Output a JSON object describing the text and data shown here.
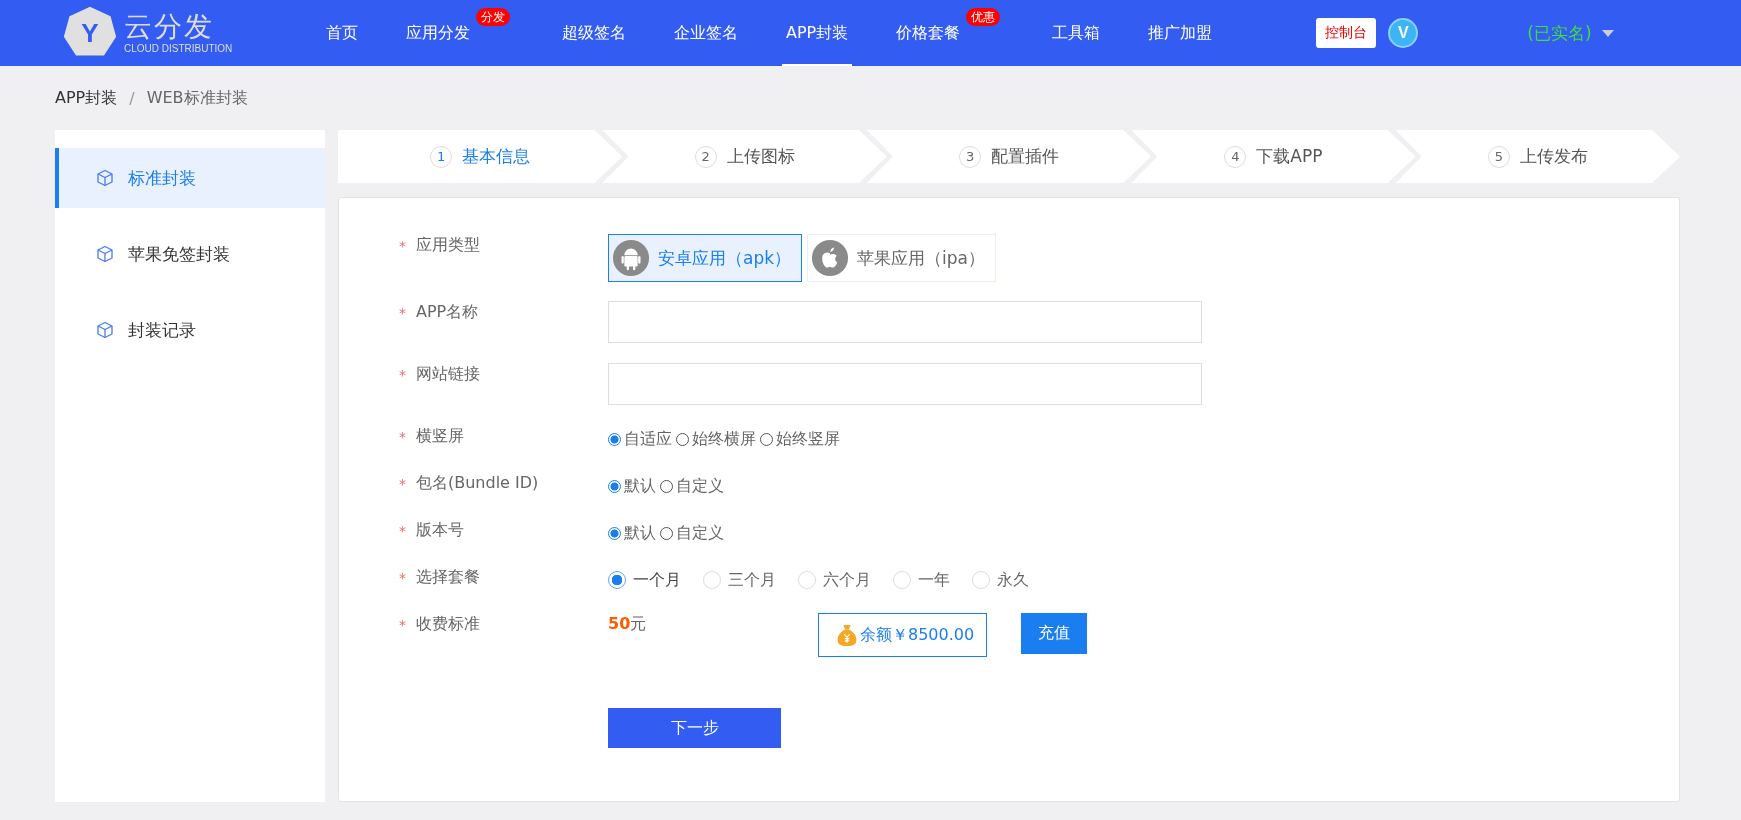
{
  "header": {
    "logo": {
      "mark": "Y",
      "title": "云分发",
      "subtitle": "CLOUD DISTRIBUTION"
    },
    "nav": [
      {
        "label": "首页",
        "selected": false
      },
      {
        "label": "应用分发",
        "selected": false,
        "badge": "分发"
      },
      {
        "label": "超级签名",
        "selected": false
      },
      {
        "label": "企业签名",
        "selected": false
      },
      {
        "label": "APP封装",
        "selected": true
      },
      {
        "label": "价格套餐",
        "selected": false,
        "badge": "优惠"
      },
      {
        "label": "工具箱",
        "selected": false
      },
      {
        "label": "推广加盟",
        "selected": false
      }
    ],
    "console_button": "控制台",
    "avatar_letter": "V",
    "user_status": "(已实名)"
  },
  "breadcrumb": {
    "items": [
      "APP封装",
      "WEB标准封装"
    ],
    "separator": "/"
  },
  "sidebar": {
    "items": [
      {
        "label": "标准封装",
        "selected": true
      },
      {
        "label": "苹果免签封装",
        "selected": false
      },
      {
        "label": "封装记录",
        "selected": false
      }
    ]
  },
  "steps": [
    {
      "number": "1",
      "label": "基本信息",
      "selected": true
    },
    {
      "number": "2",
      "label": "上传图标",
      "selected": false
    },
    {
      "number": "3",
      "label": "配置插件",
      "selected": false
    },
    {
      "number": "4",
      "label": "下载APP",
      "selected": false
    },
    {
      "number": "5",
      "label": "上传发布",
      "selected": false
    }
  ],
  "form": {
    "rows": [
      {
        "kind": "apptype",
        "label": "应用类型",
        "required_mark": "*",
        "options": [
          {
            "label": "安卓应用（apk）",
            "selected": true
          },
          {
            "label": "苹果应用（ipa）",
            "selected": false
          }
        ]
      },
      {
        "kind": "input",
        "label": "APP名称",
        "required_mark": "*"
      },
      {
        "kind": "input",
        "label": "网站链接",
        "required_mark": "*"
      },
      {
        "kind": "radio",
        "label": "横竖屏",
        "required_mark": "*",
        "options": [
          {
            "label": "自适应",
            "selected": true
          },
          {
            "label": "始终横屏",
            "selected": false
          },
          {
            "label": "始终竖屏",
            "selected": false
          }
        ]
      },
      {
        "kind": "radio",
        "label": "包名(Bundle ID)",
        "required_mark": "*",
        "options": [
          {
            "label": "默认",
            "selected": true
          },
          {
            "label": "自定义",
            "selected": false
          }
        ]
      },
      {
        "kind": "radio",
        "label": "版本号",
        "required_mark": "*",
        "options": [
          {
            "label": "默认",
            "selected": true
          },
          {
            "label": "自定义",
            "selected": false
          }
        ]
      },
      {
        "kind": "plan",
        "label": "选择套餐",
        "required_mark": "*",
        "options": [
          {
            "label": "一个月",
            "selected": true
          },
          {
            "label": "三个月",
            "selected": false
          },
          {
            "label": "六个月",
            "selected": false
          },
          {
            "label": "一年",
            "selected": false
          },
          {
            "label": "永久",
            "selected": false
          }
        ]
      },
      {
        "kind": "price",
        "label": "收费标准",
        "required_mark": "*",
        "amount": "50",
        "unit": "元",
        "balance": "余额￥8500.00",
        "recharge_button": "充值"
      }
    ],
    "next_button": "下一步"
  }
}
